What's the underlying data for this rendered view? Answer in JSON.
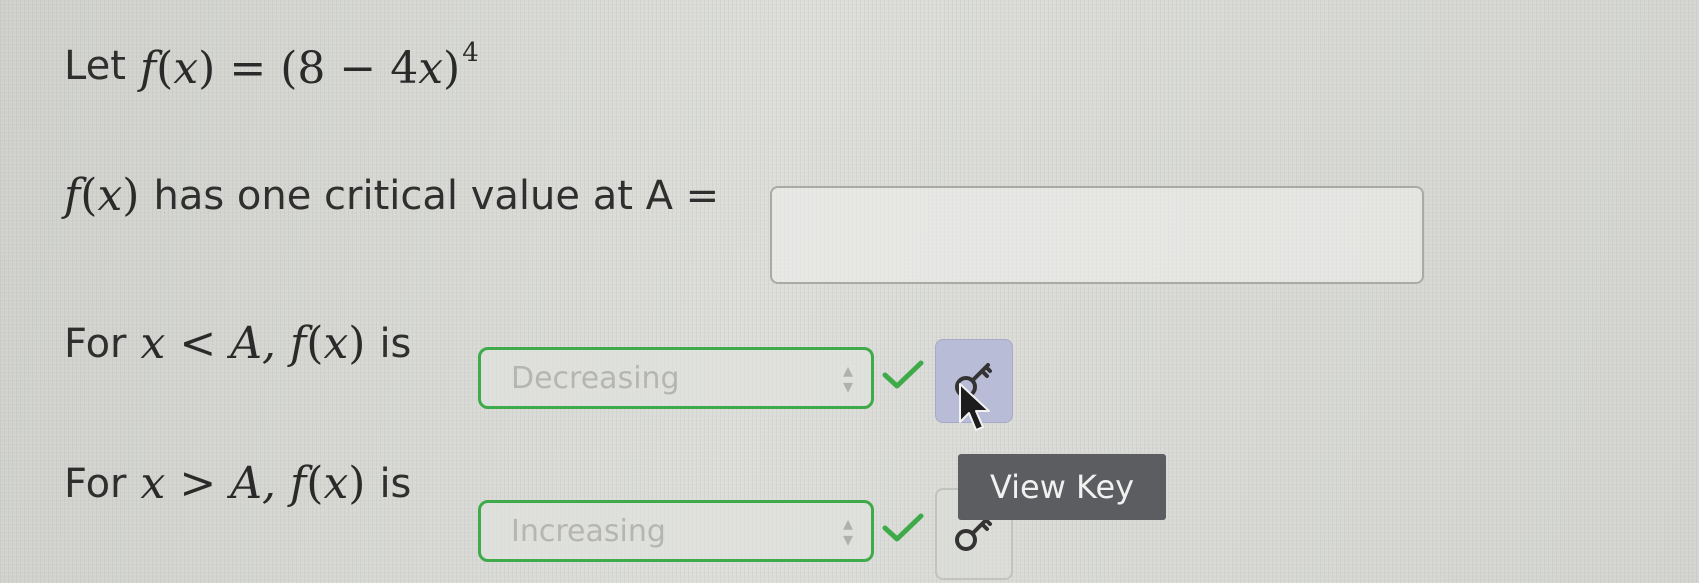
{
  "question": {
    "function_label": "Let",
    "function_name": "f",
    "variable": "x",
    "function_expression_left": "(8 − 4",
    "function_expression_right": ")",
    "exponent": "4",
    "critical_text": "has one critical value at A =",
    "critical_input": {
      "value": "",
      "placeholder": ""
    },
    "left_interval": {
      "prefix": "For",
      "relation": "<",
      "bound": "A,",
      "suffix": "is",
      "selected": "Decreasing",
      "status": "correct"
    },
    "right_interval": {
      "prefix": "For",
      "relation": ">",
      "bound": "A,",
      "suffix": "is",
      "selected": "Increasing",
      "status": "correct"
    }
  },
  "tooltip": {
    "text": "View Key"
  },
  "colors": {
    "correct": "#3faa4a",
    "key_button_active": "#b9bcd6",
    "tooltip_bg": "#5b5d60"
  },
  "icons": {
    "check": "checkmark-icon",
    "key": "key-icon",
    "cursor": "arrow-cursor-icon"
  }
}
